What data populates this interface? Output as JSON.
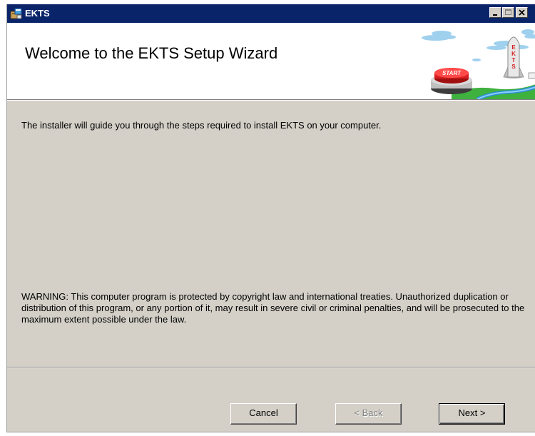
{
  "window": {
    "title": "EKTS"
  },
  "banner": {
    "title": "Welcome to the EKTS Setup Wizard",
    "art_button_text": "START",
    "art_rocket_text": "EKTS"
  },
  "content": {
    "intro": "The installer will guide you through the steps required to install EKTS on your computer.",
    "warning": "WARNING: This computer program is protected by copyright law and international treaties. Unauthorized duplication or distribution of this program, or any portion of it, may result in severe civil or criminal penalties, and will be prosecuted to the maximum extent possible under the law."
  },
  "buttons": {
    "cancel": "Cancel",
    "back": "< Back",
    "next": "Next >",
    "back_enabled": false
  },
  "icons": {
    "app": "setup-package-icon",
    "minimize": "minimize-icon",
    "maximize": "maximize-icon",
    "close": "close-icon"
  },
  "colors": {
    "titlebar": "#0a246a",
    "dialog_bg": "#d4d0c8",
    "banner_bg": "#ffffff",
    "disabled_text": "#808080"
  }
}
